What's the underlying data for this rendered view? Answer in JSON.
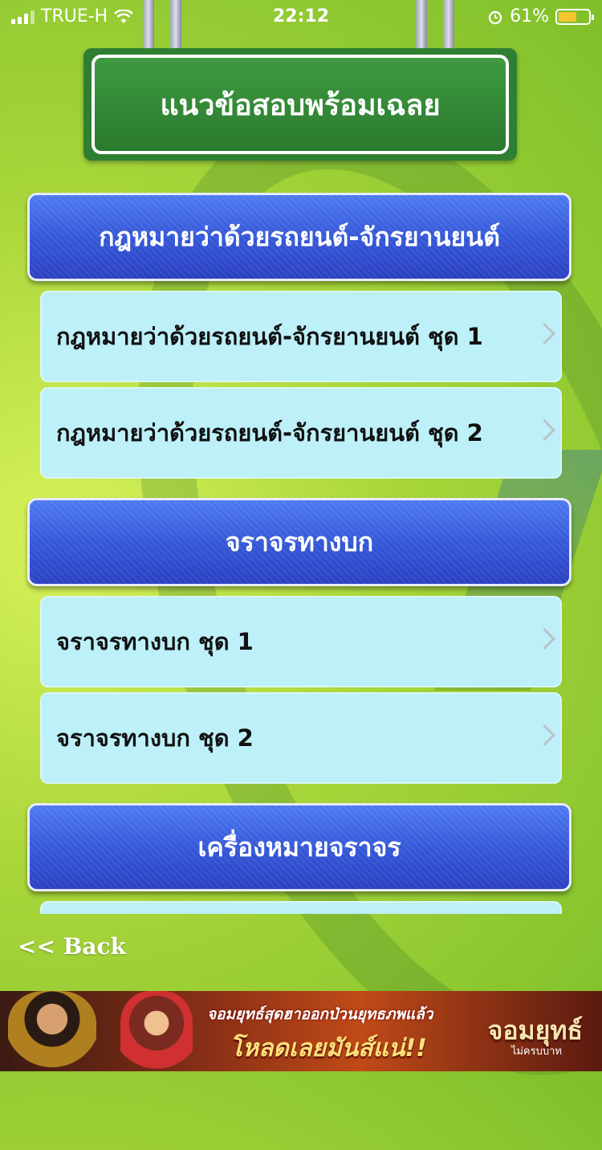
{
  "status_bar": {
    "carrier": "TRUE-H",
    "time": "22:12",
    "battery_percent": "61%",
    "battery_level": 0.61
  },
  "sign": {
    "title": "แนวข้อสอบพร้อมเฉลย"
  },
  "sections": [
    {
      "header": "กฎหมายว่าด้วยรถยนต์-จักรยานยนต์",
      "items": [
        "กฎหมายว่าด้วยรถยนต์-จักรยานยนต์ ชุด 1",
        "กฎหมายว่าด้วยรถยนต์-จักรยานยนต์ ชุด 2"
      ]
    },
    {
      "header": "จราจรทางบก",
      "items": [
        "จราจรทางบก ชุด 1",
        "จราจรทางบก ชุด 2"
      ]
    },
    {
      "header": "เครื่องหมายจราจร",
      "items": []
    }
  ],
  "back_label": "<< Back",
  "ad": {
    "line1": "จอมยุทธ์สุดฮาออกป่วนยุทธภพแล้ว",
    "line2": "โหลดเลยมันส์แน่!!",
    "logo": "จอมยุทธ์",
    "logo_sub": "ไม่ครบบาท"
  }
}
